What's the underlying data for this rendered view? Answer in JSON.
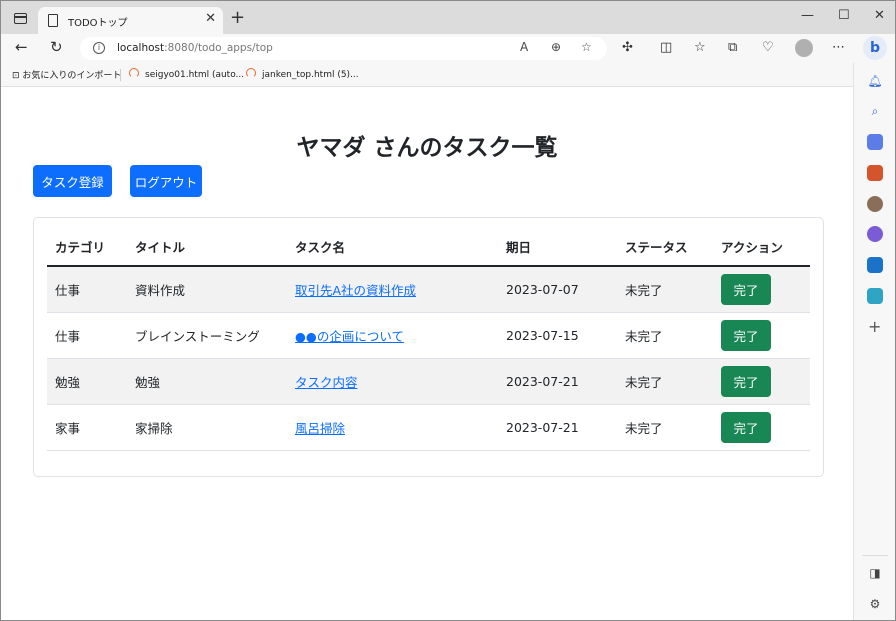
{
  "browser": {
    "tab_title": "TODOトップ",
    "url_host": "localhost",
    "url_rest": ":8080/todo_apps/top",
    "bookmarks": [
      {
        "label": "お気に入りのインポート"
      },
      {
        "label": "seigyo01.html (auto..."
      },
      {
        "label": "janken_top.html (5)..."
      }
    ]
  },
  "page": {
    "heading": "ヤマダ さんのタスク一覧",
    "register_button": "タスク登録",
    "logout_button": "ログアウト"
  },
  "table": {
    "headers": [
      "カテゴリ",
      "タイトル",
      "タスク名",
      "期日",
      "ステータス",
      "アクション"
    ],
    "rows": [
      {
        "category": "仕事",
        "title": "資料作成",
        "task": "取引先A社の資料作成",
        "due": "2023-07-07",
        "status": "未完了",
        "action": "完了"
      },
      {
        "category": "仕事",
        "title": "ブレインストーミング",
        "task": "●●の企画について",
        "due": "2023-07-15",
        "status": "未完了",
        "action": "完了"
      },
      {
        "category": "勉強",
        "title": "勉強",
        "task": "タスク内容",
        "due": "2023-07-21",
        "status": "未完了",
        "action": "完了"
      },
      {
        "category": "家事",
        "title": "家掃除",
        "task": "風呂掃除",
        "due": "2023-07-21",
        "status": "未完了",
        "action": "完了"
      }
    ]
  },
  "colors": {
    "primary": "#0d6efd",
    "success": "#198754",
    "stripe": "#f2f2f2"
  }
}
